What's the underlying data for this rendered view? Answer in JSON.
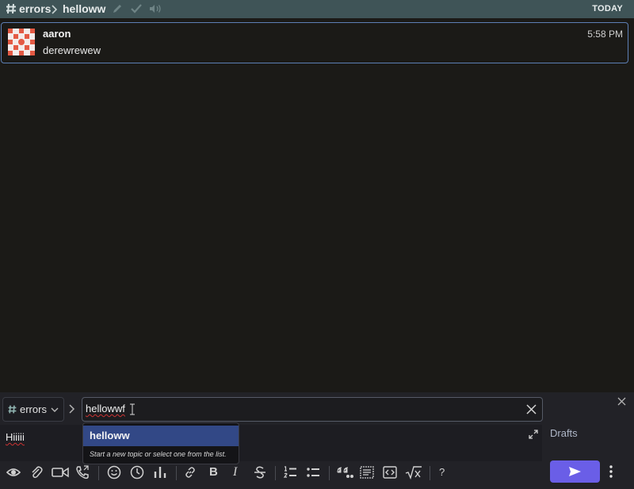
{
  "header": {
    "stream": "errors",
    "topic": "helloww",
    "date_label": "TODAY"
  },
  "message": {
    "sender": "aaron",
    "time": "5:58 PM",
    "content": "derewrewew"
  },
  "compose": {
    "stream": "errors",
    "topic_value": "hellowwf",
    "message_value": "Hiiiii",
    "drafts_label": "Drafts"
  },
  "typeahead": {
    "option": "helloww",
    "hint": "Start a new topic or select one from the list."
  },
  "toolbar": {
    "icons": [
      "eye-icon",
      "paperclip-icon",
      "video-icon",
      "phone-icon",
      "smile-icon",
      "clock-icon",
      "poll-icon",
      "link-icon",
      "bold-icon",
      "italic-icon",
      "strikethrough-icon",
      "ordered-list-icon",
      "bullet-list-icon",
      "quote-icon",
      "spoiler-icon",
      "code-icon",
      "math-icon",
      "help-icon"
    ],
    "bold_label": "B",
    "italic_label": "I",
    "help_label": "?"
  },
  "colors": {
    "header_bg": "#3f5457",
    "accent": "#6a5ee7",
    "highlight": "#324886",
    "message_border": "#5d7fb5"
  }
}
